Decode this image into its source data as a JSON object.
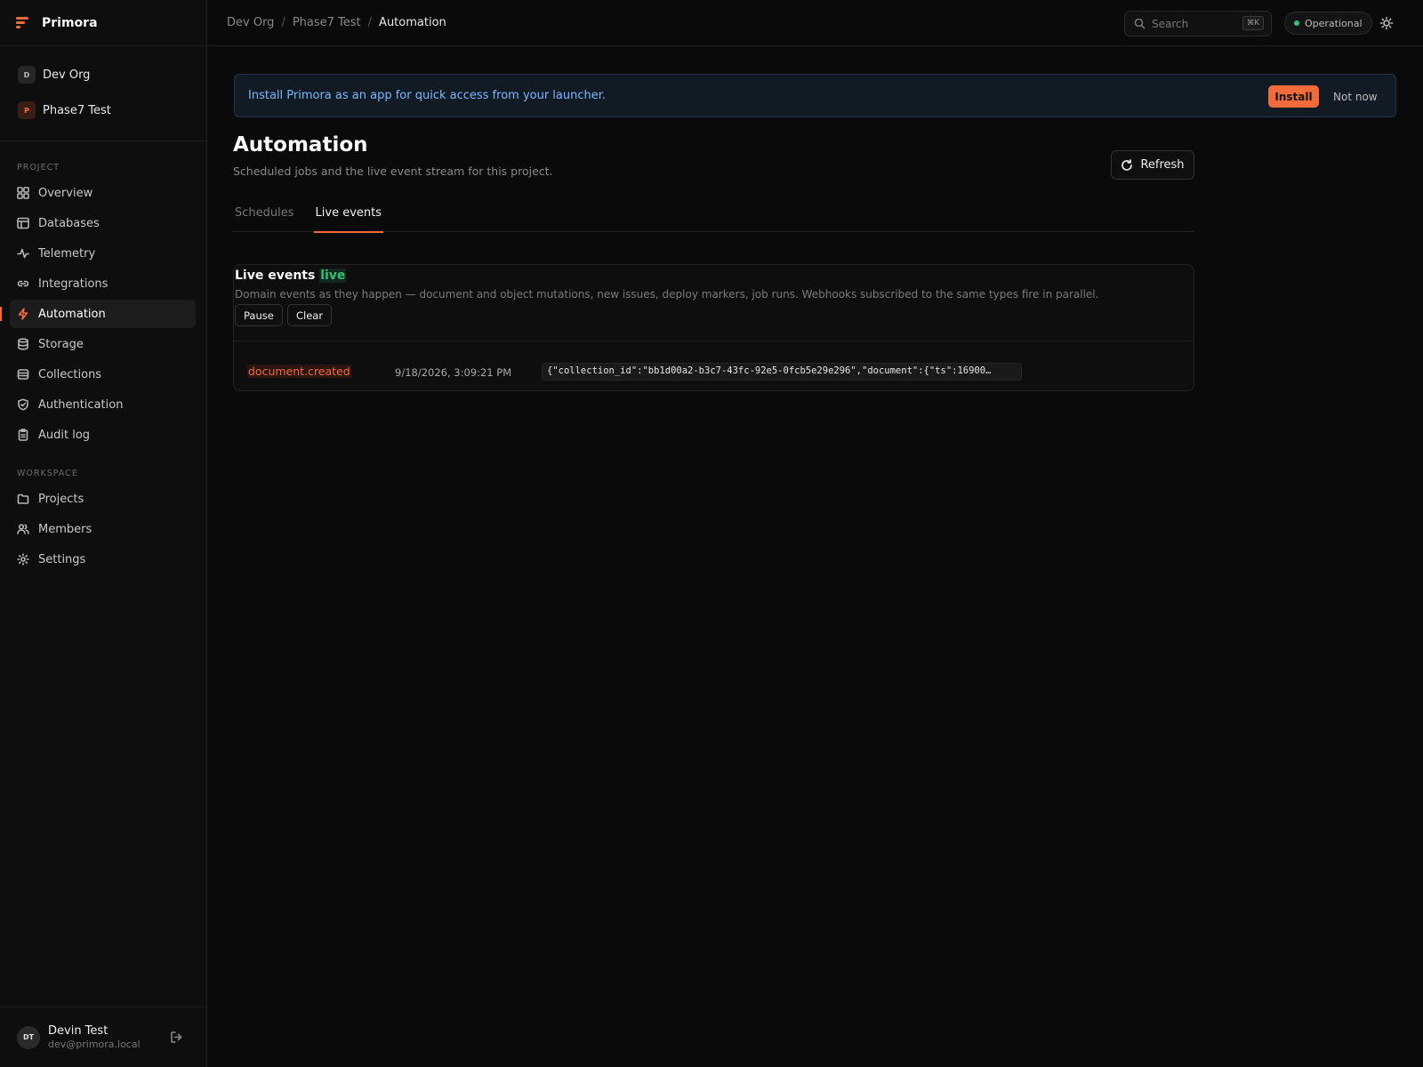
{
  "brand": {
    "name": "Primora",
    "accent": "#f26b3a"
  },
  "orgs": [
    {
      "initial": "D",
      "name": "Dev Org"
    },
    {
      "initial": "P",
      "name": "Phase7 Test"
    }
  ],
  "sidebar": {
    "project_label": "PROJECT",
    "project_items": [
      {
        "label": "Overview",
        "icon": "grid-icon"
      },
      {
        "label": "Databases",
        "icon": "table-icon"
      },
      {
        "label": "Telemetry",
        "icon": "pulse-icon"
      },
      {
        "label": "Integrations",
        "icon": "link-icon"
      },
      {
        "label": "Automation",
        "icon": "bolt-icon",
        "active": true
      },
      {
        "label": "Storage",
        "icon": "database-icon"
      },
      {
        "label": "Collections",
        "icon": "layers-icon"
      },
      {
        "label": "Authentication",
        "icon": "shield-icon"
      },
      {
        "label": "Audit log",
        "icon": "clipboard-icon"
      }
    ],
    "workspace_label": "WORKSPACE",
    "workspace_items": [
      {
        "label": "Projects",
        "icon": "folder-icon"
      },
      {
        "label": "Members",
        "icon": "users-icon"
      },
      {
        "label": "Settings",
        "icon": "gear-icon"
      }
    ]
  },
  "user": {
    "initials": "DT",
    "name": "Devin Test",
    "email": "dev@primora.local"
  },
  "topbar": {
    "breadcrumbs": [
      "Dev Org",
      "Phase7 Test",
      "Automation"
    ],
    "search_placeholder": "Search",
    "search_shortcut": "⌘K",
    "status": "Operational",
    "status_color": "#34c077"
  },
  "banner": {
    "text": "Install Primora as an app for quick access from your launcher.",
    "install_label": "Install",
    "dismiss_label": "Not now"
  },
  "page": {
    "title": "Automation",
    "subtitle": "Scheduled jobs and the live event stream for this project.",
    "refresh_label": "Refresh",
    "tabs": [
      {
        "label": "Schedules",
        "active": false
      },
      {
        "label": "Live events",
        "active": true
      }
    ]
  },
  "events": {
    "title": "Live events",
    "live_tag": "live",
    "description": "Domain events as they happen — document and object mutations, new issues, deploy markers, job runs. Webhooks subscribed to the same types fire in parallel.",
    "pause_label": "Pause",
    "clear_label": "Clear",
    "rows": [
      {
        "type": "document.created",
        "time": "9/18/2026, 3:09:21 PM",
        "payload": "{\"collection_id\":\"bb1d00a2-b3c7-43fc-92e5-0fcb5e29e296\",\"document\":{\"ts\":16900…"
      }
    ]
  }
}
